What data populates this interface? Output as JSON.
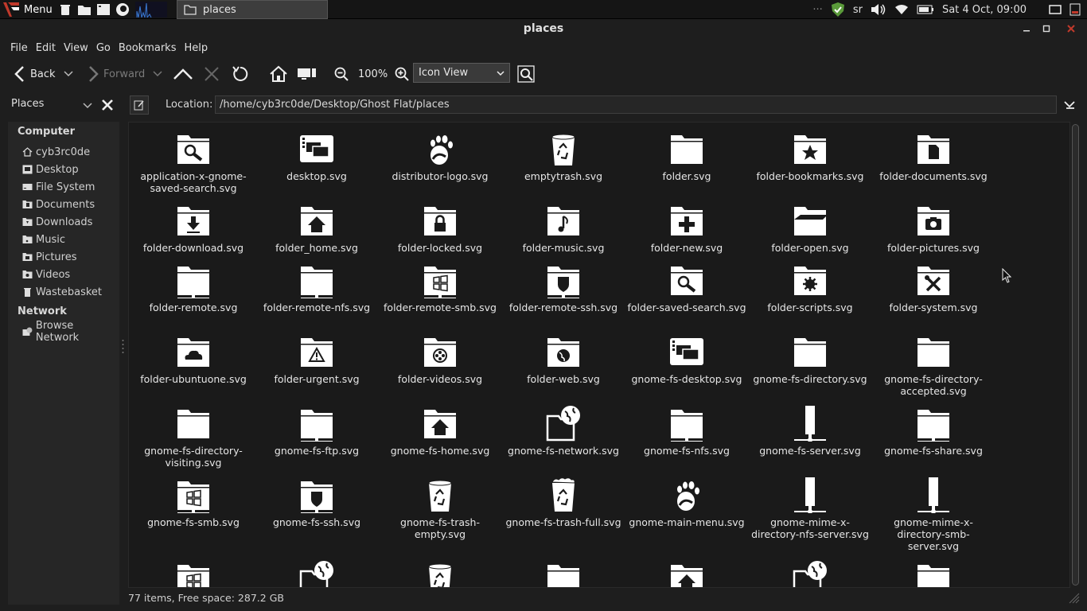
{
  "panel": {
    "menu_label": "Menu",
    "taskbar_window": "places",
    "tray": {
      "keyboard_layout": "sr",
      "clock": "Sat  4 Oct, 09:00"
    }
  },
  "window": {
    "title": "places"
  },
  "menubar": [
    "File",
    "Edit",
    "View",
    "Go",
    "Bookmarks",
    "Help"
  ],
  "toolbar": {
    "back_label": "Back",
    "forward_label": "Forward",
    "zoom_level": "100%",
    "view_mode": "Icon View"
  },
  "sidebar": {
    "header": "Places",
    "sections": [
      {
        "heading": "Computer",
        "items": [
          "cyb3rc0de",
          "Desktop",
          "File System",
          "Documents",
          "Downloads",
          "Music",
          "Pictures",
          "Videos",
          "Wastebasket"
        ]
      },
      {
        "heading": "Network",
        "items": [
          "Browse Network"
        ]
      }
    ]
  },
  "location": {
    "label": "Location:",
    "path": "/home/cyb3rc0de/Desktop/Ghost Flat/places"
  },
  "files": [
    {
      "name": "application-x-gnome-saved-search.svg",
      "icon": "saved-search-folder-icon"
    },
    {
      "name": "desktop.svg",
      "icon": "desktop-icon"
    },
    {
      "name": "distributor-logo.svg",
      "icon": "gnome-foot-icon"
    },
    {
      "name": "emptytrash.svg",
      "icon": "trash-icon"
    },
    {
      "name": "folder.svg",
      "icon": "folder-icon"
    },
    {
      "name": "folder-bookmarks.svg",
      "icon": "folder-star-icon"
    },
    {
      "name": "folder-documents.svg",
      "icon": "folder-document-icon"
    },
    {
      "name": "folder-download.svg",
      "icon": "folder-download-icon"
    },
    {
      "name": "folder_home.svg",
      "icon": "folder-home-icon"
    },
    {
      "name": "folder-locked.svg",
      "icon": "folder-lock-icon"
    },
    {
      "name": "folder-music.svg",
      "icon": "folder-music-icon"
    },
    {
      "name": "folder-new.svg",
      "icon": "folder-plus-icon"
    },
    {
      "name": "folder-open.svg",
      "icon": "folder-open-icon"
    },
    {
      "name": "folder-pictures.svg",
      "icon": "folder-camera-icon"
    },
    {
      "name": "folder-remote.svg",
      "icon": "folder-remote-icon"
    },
    {
      "name": "folder-remote-nfs.svg",
      "icon": "folder-remote-icon"
    },
    {
      "name": "folder-remote-smb.svg",
      "icon": "folder-windows-icon"
    },
    {
      "name": "folder-remote-ssh.svg",
      "icon": "folder-shield-icon"
    },
    {
      "name": "folder-saved-search.svg",
      "icon": "saved-search-folder-icon"
    },
    {
      "name": "folder-scripts.svg",
      "icon": "folder-gear-icon"
    },
    {
      "name": "folder-system.svg",
      "icon": "folder-tools-icon"
    },
    {
      "name": "folder-ubuntuone.svg",
      "icon": "folder-cloud-icon"
    },
    {
      "name": "folder-urgent.svg",
      "icon": "folder-warning-icon"
    },
    {
      "name": "folder-videos.svg",
      "icon": "folder-film-icon"
    },
    {
      "name": "folder-web.svg",
      "icon": "folder-globe-icon"
    },
    {
      "name": "gnome-fs-desktop.svg",
      "icon": "desktop-icon"
    },
    {
      "name": "gnome-fs-directory.svg",
      "icon": "folder-icon"
    },
    {
      "name": "gnome-fs-directory-accepted.svg",
      "icon": "folder-icon"
    },
    {
      "name": "gnome-fs-directory-visiting.svg",
      "icon": "folder-icon"
    },
    {
      "name": "gnome-fs-ftp.svg",
      "icon": "folder-remote-icon"
    },
    {
      "name": "gnome-fs-home.svg",
      "icon": "folder-home-icon"
    },
    {
      "name": "gnome-fs-network.svg",
      "icon": "network-globe-icon"
    },
    {
      "name": "gnome-fs-nfs.svg",
      "icon": "folder-remote-icon"
    },
    {
      "name": "gnome-fs-server.svg",
      "icon": "server-icon"
    },
    {
      "name": "gnome-fs-share.svg",
      "icon": "folder-remote-icon"
    },
    {
      "name": "gnome-fs-smb.svg",
      "icon": "folder-windows-icon"
    },
    {
      "name": "gnome-fs-ssh.svg",
      "icon": "folder-shield-icon"
    },
    {
      "name": "gnome-fs-trash-empty.svg",
      "icon": "trash-icon"
    },
    {
      "name": "gnome-fs-trash-full.svg",
      "icon": "trash-full-icon"
    },
    {
      "name": "gnome-main-menu.svg",
      "icon": "gnome-foot-icon"
    },
    {
      "name": "gnome-mime-x-directory-nfs-server.svg",
      "icon": "server-icon"
    },
    {
      "name": "gnome-mime-x-directory-smb-server.svg",
      "icon": "server-icon"
    },
    {
      "name": "",
      "icon": "folder-windows-icon"
    },
    {
      "name": "",
      "icon": "network-globe-icon"
    },
    {
      "name": "",
      "icon": "trash-icon"
    },
    {
      "name": "",
      "icon": "folder-icon"
    },
    {
      "name": "",
      "icon": "folder-home-icon"
    },
    {
      "name": "",
      "icon": "network-globe-icon"
    },
    {
      "name": "",
      "icon": "folder-icon"
    }
  ],
  "status": "77 items, Free space: 287.2 GB"
}
